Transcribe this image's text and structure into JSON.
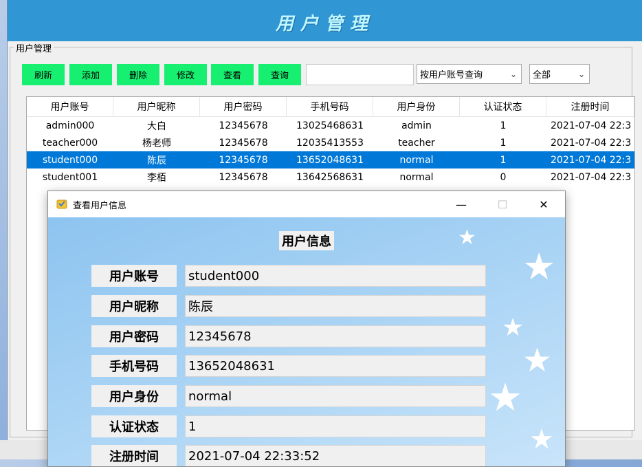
{
  "main_window": {
    "banner_title": "用户管理",
    "group_label": "用户管理"
  },
  "toolbar": {
    "refresh": "刷新",
    "add": "添加",
    "delete": "删除",
    "modify": "修改",
    "view": "查看",
    "query": "查询",
    "search_value": "",
    "query_mode": "按用户账号查询",
    "filter": "全部"
  },
  "table": {
    "columns": [
      "用户账号",
      "用户昵称",
      "用户密码",
      "手机号码",
      "用户身份",
      "认证状态",
      "注册时间"
    ],
    "rows": [
      [
        "admin000",
        "大白",
        "12345678",
        "13025468631",
        "admin",
        "1",
        "2021-07-04 22:3"
      ],
      [
        "teacher000",
        "杨老师",
        "12345678",
        "12035413553",
        "teacher",
        "1",
        "2021-07-04 22:3"
      ],
      [
        "student000",
        "陈辰",
        "12345678",
        "13652048631",
        "normal",
        "1",
        "2021-07-04 22:3"
      ],
      [
        "student001",
        "李栢",
        "12345678",
        "13642568631",
        "normal",
        "0",
        "2021-07-04 22:3"
      ]
    ],
    "selected_row": 2
  },
  "dialog": {
    "title": "查看用户信息",
    "heading": "用户信息",
    "controls": {
      "minimize": "—",
      "maximize": "☐",
      "close": "✕"
    },
    "fields": [
      {
        "label": "用户账号",
        "value": "student000"
      },
      {
        "label": "用户昵称",
        "value": "陈辰"
      },
      {
        "label": "用户密码",
        "value": "12345678"
      },
      {
        "label": "手机号码",
        "value": "13652048631"
      },
      {
        "label": "用户身份",
        "value": "normal"
      },
      {
        "label": "认证状态",
        "value": "1"
      },
      {
        "label": "注册时间",
        "value": "2021-07-04 22:33:52"
      }
    ]
  },
  "colors": {
    "banner": "#3196d4",
    "button": "#17ef70",
    "selection": "#0078d7"
  }
}
